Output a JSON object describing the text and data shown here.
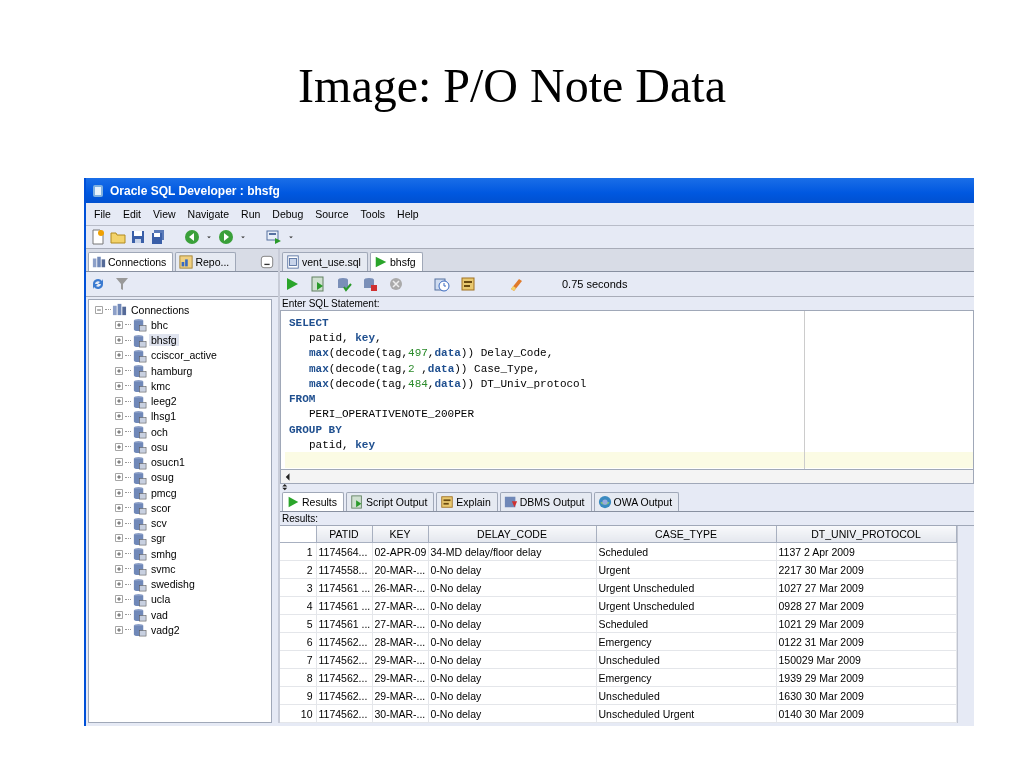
{
  "slide": {
    "title": "Image: P/O Note Data"
  },
  "window": {
    "title": "Oracle SQL Developer : bhsfg"
  },
  "menu": [
    "File",
    "Edit",
    "View",
    "Navigate",
    "Run",
    "Debug",
    "Source",
    "Tools",
    "Help"
  ],
  "navigator": {
    "tabs": [
      {
        "label": "Connections",
        "selected": true
      },
      {
        "label": "Repo...",
        "selected": false
      }
    ],
    "tree": [
      {
        "label": "Connections",
        "expanded": true,
        "selected": false,
        "children": [
          {
            "label": "bhc",
            "expanded": false,
            "selected": false
          },
          {
            "label": "bhsfg",
            "expanded": false,
            "selected": true
          },
          {
            "label": "cciscor_active",
            "expanded": false,
            "selected": false
          },
          {
            "label": "hamburg",
            "expanded": false,
            "selected": false
          },
          {
            "label": "kmc",
            "expanded": false,
            "selected": false
          },
          {
            "label": "leeg2",
            "expanded": false,
            "selected": false
          },
          {
            "label": "lhsg1",
            "expanded": false,
            "selected": false
          },
          {
            "label": "och",
            "expanded": false,
            "selected": false
          },
          {
            "label": "osu",
            "expanded": false,
            "selected": false
          },
          {
            "label": "osucn1",
            "expanded": false,
            "selected": false
          },
          {
            "label": "osug",
            "expanded": false,
            "selected": false
          },
          {
            "label": "pmcg",
            "expanded": false,
            "selected": false
          },
          {
            "label": "scor",
            "expanded": false,
            "selected": false
          },
          {
            "label": "scv",
            "expanded": false,
            "selected": false
          },
          {
            "label": "sgr",
            "expanded": false,
            "selected": false
          },
          {
            "label": "smhg",
            "expanded": false,
            "selected": false
          },
          {
            "label": "svmc",
            "expanded": false,
            "selected": false
          },
          {
            "label": "swedishg",
            "expanded": false,
            "selected": false
          },
          {
            "label": "ucla",
            "expanded": false,
            "selected": false
          },
          {
            "label": "vad",
            "expanded": false,
            "selected": false
          },
          {
            "label": "vadg2",
            "expanded": false,
            "selected": false
          }
        ]
      }
    ]
  },
  "editor": {
    "tabs": [
      {
        "label": "vent_use.sql",
        "kind": "file",
        "selected": false
      },
      {
        "label": "bhsfg",
        "kind": "worksheet",
        "selected": true
      }
    ],
    "elapsed": "0.75 seconds",
    "prompt": "Enter SQL Statement:",
    "lines": [
      {
        "indented": false,
        "tokens": [
          {
            "text": "SELECT",
            "kind": "keyword"
          }
        ]
      },
      {
        "indented": true,
        "tokens": [
          {
            "text": "patid, ",
            "kind": "plain"
          },
          {
            "text": "key",
            "kind": "keyword"
          },
          {
            "text": ",",
            "kind": "plain"
          }
        ]
      },
      {
        "indented": true,
        "tokens": [
          {
            "text": "max",
            "kind": "keyword"
          },
          {
            "text": "(decode(tag,",
            "kind": "plain"
          },
          {
            "text": "497",
            "kind": "number"
          },
          {
            "text": ",",
            "kind": "plain"
          },
          {
            "text": "data",
            "kind": "keyword"
          },
          {
            "text": ")) Delay_Code,",
            "kind": "plain"
          }
        ]
      },
      {
        "indented": true,
        "tokens": [
          {
            "text": "max",
            "kind": "keyword"
          },
          {
            "text": "(decode(tag,",
            "kind": "plain"
          },
          {
            "text": "2",
            "kind": "number"
          },
          {
            "text": " ,",
            "kind": "plain"
          },
          {
            "text": "data",
            "kind": "keyword"
          },
          {
            "text": ")) Case_Type,",
            "kind": "plain"
          }
        ]
      },
      {
        "indented": true,
        "tokens": [
          {
            "text": "max",
            "kind": "keyword"
          },
          {
            "text": "(decode(tag,",
            "kind": "plain"
          },
          {
            "text": "484",
            "kind": "number"
          },
          {
            "text": ",",
            "kind": "plain"
          },
          {
            "text": "data",
            "kind": "keyword"
          },
          {
            "text": ")) DT_Univ_protocol",
            "kind": "plain"
          }
        ]
      },
      {
        "indented": false,
        "tokens": [
          {
            "text": "FROM",
            "kind": "keyword"
          }
        ]
      },
      {
        "indented": true,
        "tokens": [
          {
            "text": "PERI_OPERATIVENOTE_200PER",
            "kind": "plain"
          }
        ]
      },
      {
        "indented": false,
        "tokens": [
          {
            "text": "GROUP BY",
            "kind": "keyword"
          }
        ]
      },
      {
        "indented": true,
        "tokens": [
          {
            "text": "patid, ",
            "kind": "plain"
          },
          {
            "text": "key",
            "kind": "keyword"
          }
        ]
      }
    ]
  },
  "results": {
    "tabs": [
      {
        "label": "Results",
        "kind": "run",
        "selected": true
      },
      {
        "label": "Script Output",
        "kind": "script",
        "selected": false
      },
      {
        "label": "Explain",
        "kind": "explain",
        "selected": false
      },
      {
        "label": "DBMS Output",
        "kind": "dbms",
        "selected": false
      },
      {
        "label": "OWA Output",
        "kind": "owa",
        "selected": false
      }
    ],
    "label": "Results:",
    "columns": [
      "PATID",
      "KEY",
      "DELAY_CODE",
      "CASE_TYPE",
      "DT_UNIV_PROTOCOL"
    ],
    "rows": [
      {
        "number": "1",
        "cells": [
          "1174564...",
          "02-APR-09",
          "34-MD delay/floor delay",
          "Scheduled",
          "1137  2 Apr 2009"
        ]
      },
      {
        "number": "2",
        "cells": [
          "1174558...",
          "20-MAR-...",
          "0-No delay",
          "Urgent",
          "2217 30 Mar 2009"
        ]
      },
      {
        "number": "3",
        "cells": [
          "1174561 ...",
          "26-MAR-...",
          "0-No delay",
          "Urgent Unscheduled",
          "1027 27 Mar 2009"
        ]
      },
      {
        "number": "4",
        "cells": [
          "1174561 ...",
          "27-MAR-...",
          "0-No delay",
          "Urgent Unscheduled",
          "0928 27 Mar 2009"
        ]
      },
      {
        "number": "5",
        "cells": [
          "1174561 ...",
          "27-MAR-...",
          "0-No delay",
          "Scheduled",
          "1021 29 Mar 2009"
        ]
      },
      {
        "number": "6",
        "cells": [
          "1174562...",
          "28-MAR-...",
          "0-No delay",
          "Emergency",
          "0122 31 Mar 2009"
        ]
      },
      {
        "number": "7",
        "cells": [
          "1174562...",
          "29-MAR-...",
          "0-No delay",
          "Unscheduled",
          "150029 Mar 2009"
        ]
      },
      {
        "number": "8",
        "cells": [
          "1174562...",
          "29-MAR-...",
          "0-No delay",
          "Emergency",
          "1939 29 Mar 2009"
        ]
      },
      {
        "number": "9",
        "cells": [
          "1174562...",
          "29-MAR-...",
          "0-No delay",
          "Unscheduled",
          "1630 30 Mar 2009"
        ]
      },
      {
        "number": "10",
        "cells": [
          "1174562...",
          "30-MAR-...",
          "0-No delay",
          "Unscheduled Urgent",
          "0140 30 Mar 2009"
        ]
      }
    ]
  }
}
